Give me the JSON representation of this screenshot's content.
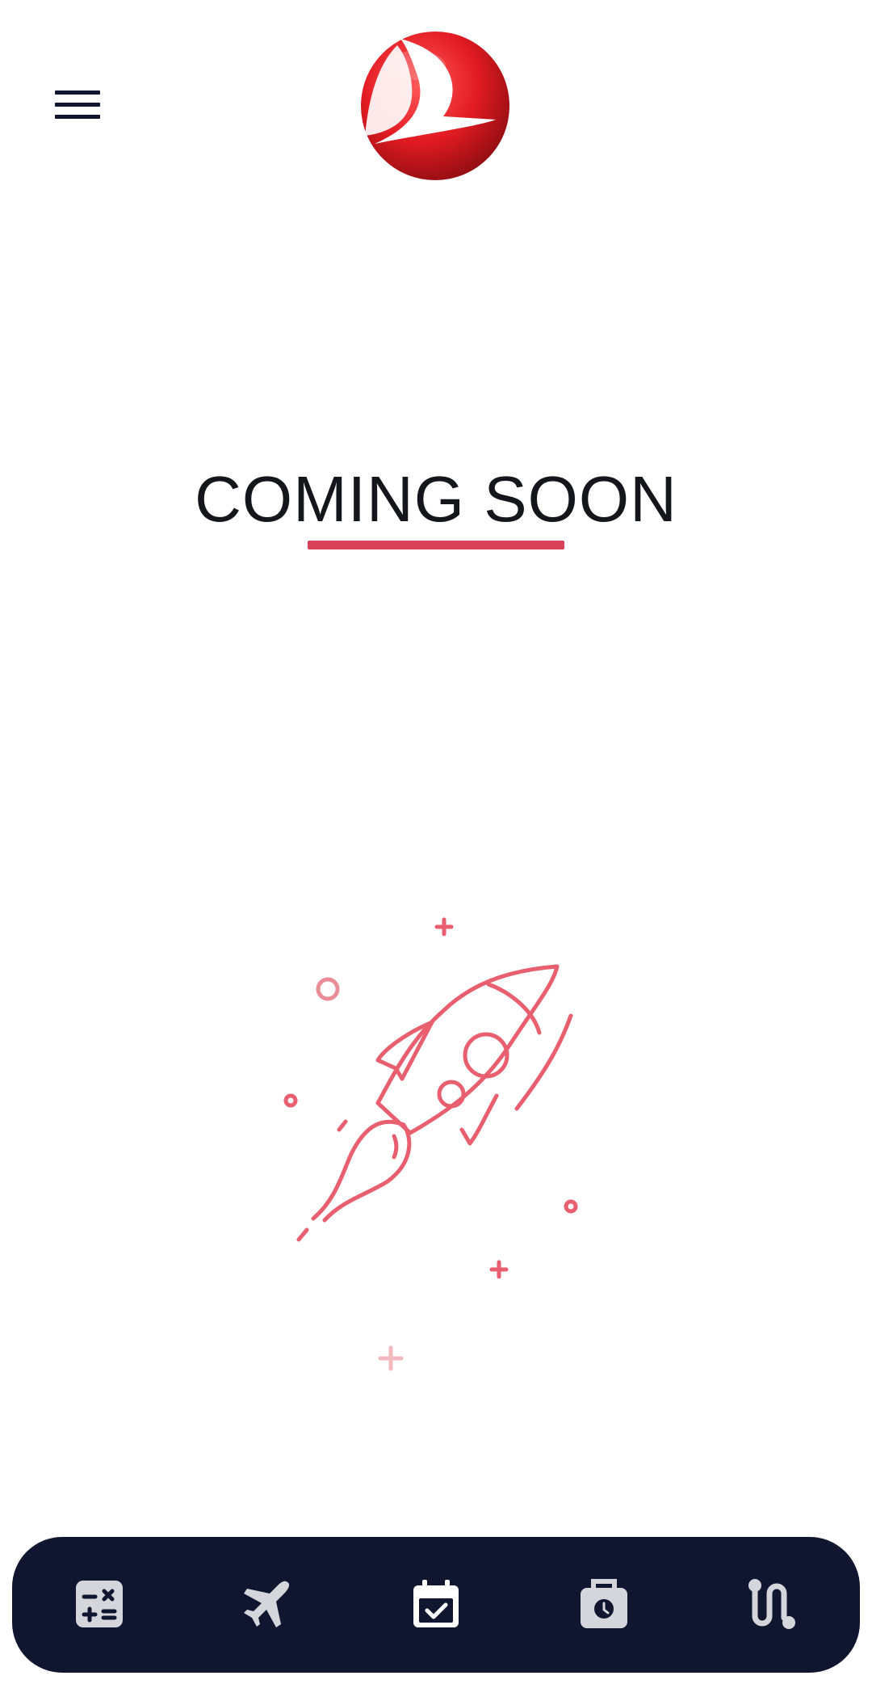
{
  "header": {
    "menu_icon": "hamburger-menu-icon",
    "logo": "turkish-airlines-logo",
    "brand_color": "#e31b23"
  },
  "main": {
    "title": "COMING SOON",
    "accent_color": "#d9405a",
    "illustration": "rocket-launch-illustration"
  },
  "bottom_nav": {
    "background": "#10162f",
    "icon_color": "#d4d6dc",
    "items": [
      {
        "icon": "calculator-icon"
      },
      {
        "icon": "airplane-icon"
      },
      {
        "icon": "calendar-check-icon"
      },
      {
        "icon": "luggage-clock-icon"
      },
      {
        "icon": "route-icon"
      }
    ]
  }
}
